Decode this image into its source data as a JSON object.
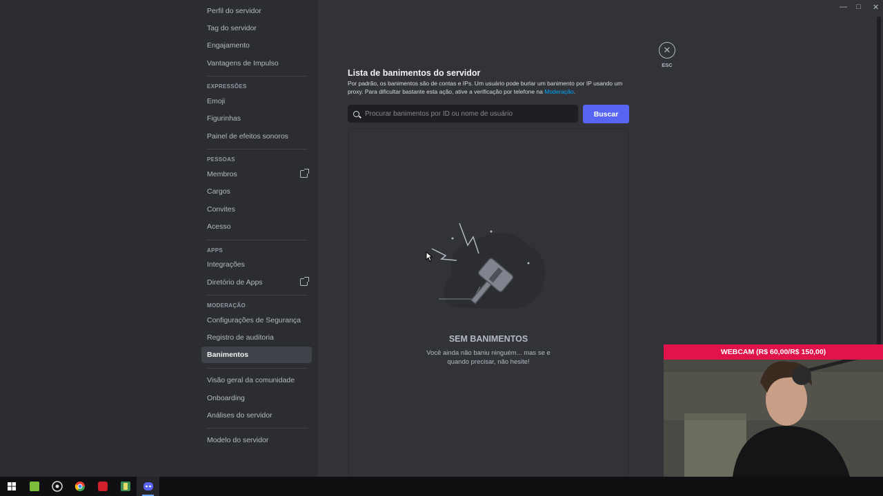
{
  "nav": {
    "items_top": [
      {
        "label": "Perfil do servidor"
      },
      {
        "label": "Tag do servidor"
      },
      {
        "label": "Engajamento"
      },
      {
        "label": "Vantagens de Impulso"
      }
    ],
    "expressions_header": "EXPRESSÕES",
    "expressions": [
      {
        "label": "Emoji"
      },
      {
        "label": "Figurinhas"
      },
      {
        "label": "Painel de efeitos sonoros"
      }
    ],
    "people_header": "PESSOAS",
    "people": [
      {
        "label": "Membros"
      },
      {
        "label": "Cargos"
      },
      {
        "label": "Convites"
      },
      {
        "label": "Acesso"
      }
    ],
    "apps_header": "APPS",
    "apps": [
      {
        "label": "Integrações"
      },
      {
        "label": "Diretório de Apps"
      }
    ],
    "moderation_header": "MODERAÇÃO",
    "moderation": [
      {
        "label": "Configurações de Segurança"
      },
      {
        "label": "Registro de auditoria"
      },
      {
        "label": "Banimentos"
      }
    ],
    "community": [
      {
        "label": "Visão geral da comunidade"
      },
      {
        "label": "Onboarding"
      },
      {
        "label": "Análises do servidor"
      }
    ],
    "template": {
      "label": "Modelo do servidor"
    }
  },
  "close": {
    "esc_label": "ESC"
  },
  "bans": {
    "title": "Lista de banimentos do servidor",
    "description": "Por padrão, os banimentos são de contas e IPs. Um usuário pode burlar um banimento por IP usando um proxy. Para dificultar bastante esta ação, ative a verificação por telefone na",
    "description_link": "Moderação",
    "description_end": ".",
    "search_placeholder": "Procurar banimentos por ID ou nome de usuário",
    "search_button": "Buscar",
    "empty_title": "SEM BANIMENTOS",
    "empty_subtitle": "Você ainda não baniu ninguém... mas se e quando precisar, não hesite!"
  },
  "webcam": {
    "label": "WEBCAM (R$ 60,00/R$ 150,00)"
  },
  "colors": {
    "accent": "#5865f2",
    "link": "#00a8fc",
    "webcam_badge": "#e0134a"
  }
}
